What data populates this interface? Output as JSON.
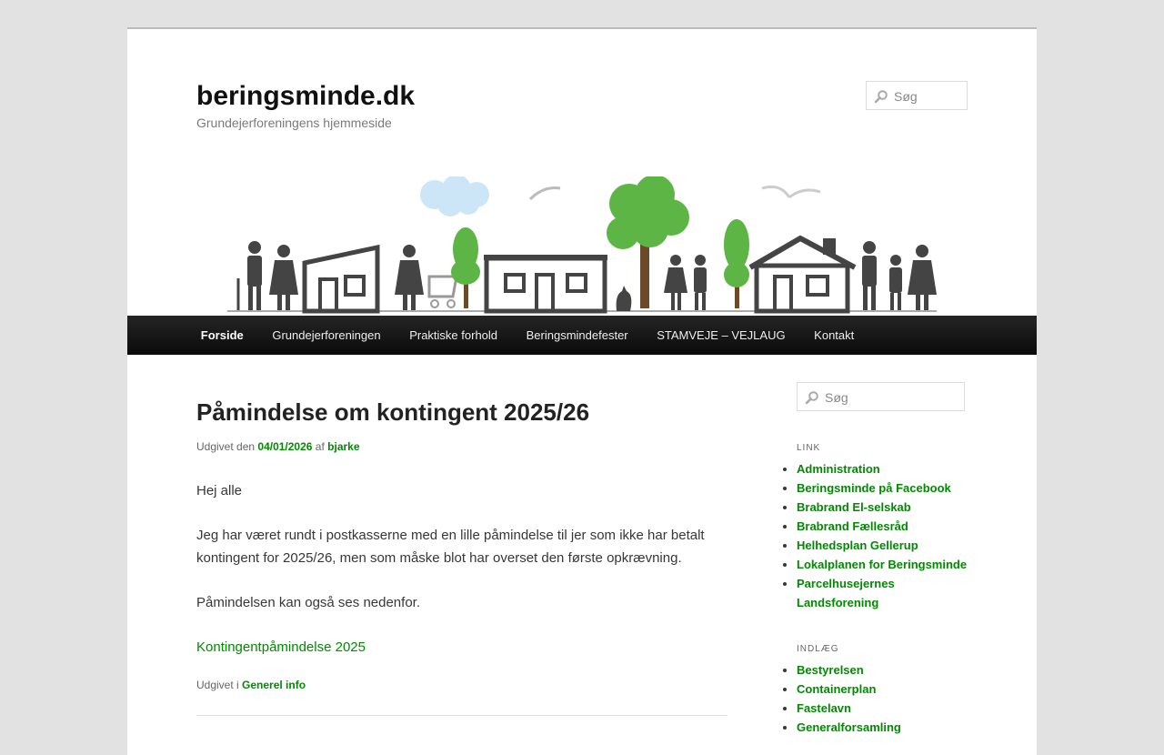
{
  "site": {
    "title": "beringsminde.dk",
    "description": "Grundejerforeningens hjemmeside"
  },
  "header_search": {
    "placeholder": "Søg"
  },
  "nav": {
    "items": [
      {
        "label": "Forside",
        "current": true
      },
      {
        "label": "Grundejerforeningen"
      },
      {
        "label": "Praktiske forhold"
      },
      {
        "label": "Beringsmindefester"
      },
      {
        "label": "STAMVEJE – VEJLAUG"
      },
      {
        "label": "Kontakt"
      }
    ]
  },
  "post": {
    "title": "Påmindelse om kontingent 2025/26",
    "meta_prefix": "Udgivet den",
    "date": "04/01/2026",
    "meta_by": "af",
    "author": "bjarke",
    "paragraphs": [
      "Hej alle",
      "Jeg har været rundt i postkasserne med en lille påmindelse til jer som ikke har betalt kontingent for 2025/26, men som måske blot har overset den første opkrævning.",
      "Påmindelsen kan også ses nedenfor."
    ],
    "attachment_link": "Kontingentpåmindelse 2025",
    "footer_prefix": "Udgivet i",
    "category": "Generel info"
  },
  "sidebar": {
    "search_placeholder": "Søg",
    "widgets": [
      {
        "title": "LINK",
        "items": [
          "Administration",
          "Beringsminde på Facebook",
          "Brabrand El-selskab",
          "Brabrand Fællesråd",
          "Helhedsplan Gellerup",
          "Lokalplanen for Beringsminde",
          "Parcelhusejernes Landsforening"
        ]
      },
      {
        "title": "INDLÆG",
        "items": [
          "Bestyrelsen",
          "Containerplan",
          "Fastelavn",
          "Generalforsamling"
        ]
      }
    ]
  },
  "colors": {
    "link": "#008a00",
    "nav_bg": "#1a1a1a",
    "page_bg": "#e2e2e2"
  }
}
